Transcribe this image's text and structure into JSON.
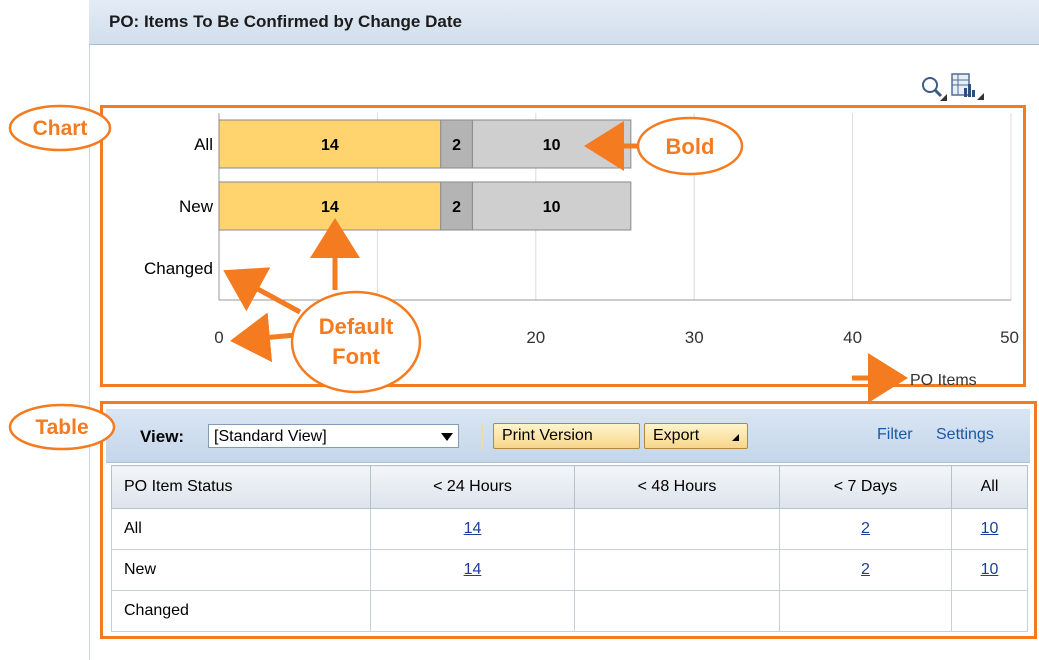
{
  "window": {
    "title": "PO: Items To Be Confirmed by Change Date"
  },
  "toolbar_icons": [
    "zoom-icon",
    "chart-settings-icon"
  ],
  "chart_data": {
    "type": "bar",
    "orientation": "horizontal",
    "stacked": true,
    "categories": [
      "All",
      "New",
      "Changed"
    ],
    "series": [
      {
        "values": [
          14,
          14,
          0
        ],
        "color": "#ffd36e"
      },
      {
        "values": [
          2,
          2,
          0
        ],
        "color": "#b4b4b4"
      },
      {
        "values": [
          10,
          10,
          0
        ],
        "color": "#cfcfcf"
      }
    ],
    "xticks": [
      "0",
      "20",
      "30",
      "40",
      "50"
    ],
    "xlim": [
      0,
      50
    ],
    "xlabel": "PO Items",
    "grid": true
  },
  "table_panel": {
    "view_label": "View:",
    "view_selected": "[Standard View]",
    "print_label": "Print Version",
    "export_label": "Export",
    "filter_label": "Filter",
    "settings_label": "Settings",
    "columns": [
      "PO Item Status",
      "< 24 Hours",
      "< 48 Hours",
      "< 7 Days",
      "All"
    ],
    "rows": [
      {
        "status": "All",
        "h24": "14",
        "h48": "",
        "d7": "2",
        "all": "10"
      },
      {
        "status": "New",
        "h24": "14",
        "h48": "",
        "d7": "2",
        "all": "10"
      },
      {
        "status": "Changed",
        "h24": "",
        "h48": "",
        "d7": "",
        "all": ""
      }
    ]
  },
  "annotations": {
    "chart": "Chart",
    "table": "Table",
    "bold": "Bold",
    "default_font_1": "Default",
    "default_font_2": "Font",
    "color": "#f47b20"
  }
}
